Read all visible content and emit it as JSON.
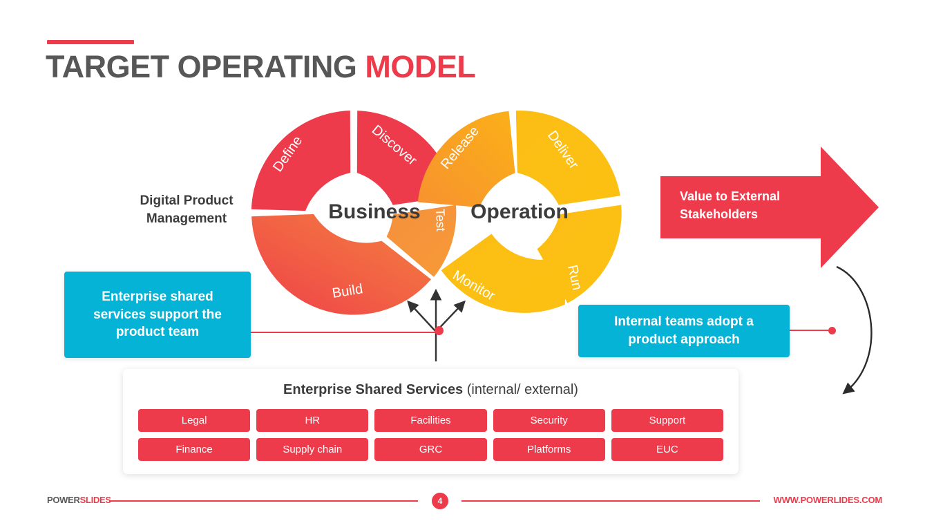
{
  "header": {
    "title_main": "TARGET OPERATING",
    "title_accent": "MODEL"
  },
  "left_label": {
    "line1": "Digital Product",
    "line2": "Management"
  },
  "diagram": {
    "left_ring": {
      "center_label": "Business",
      "segments": [
        "Define",
        "Discover",
        "Test",
        "Build"
      ]
    },
    "right_ring": {
      "center_label": "Operation",
      "segments": [
        "Release",
        "Deliver",
        "Run",
        "Monitor"
      ]
    }
  },
  "value_arrow": {
    "line1": "Value to External",
    "line2": "Stakeholders"
  },
  "callouts": {
    "left": "Enterprise shared services support the product team",
    "right": "Internal teams adopt a product approach"
  },
  "shared_services": {
    "title_bold": "Enterprise Shared Services",
    "title_normal": "(internal/ external)",
    "chips": [
      "Legal",
      "HR",
      "Facilities",
      "Security",
      "Support",
      "Finance",
      "Supply chain",
      "GRC",
      "Platforms",
      "EUC"
    ]
  },
  "footer": {
    "logo_main": "POWER",
    "logo_accent": "SLIDES",
    "page_number": "4",
    "url": "WWW.POWERLIDES.COM"
  },
  "colors": {
    "red": "#ee3b4b",
    "orange": "#f5853f",
    "yellow": "#fcbe14",
    "cyan": "#05b3d6",
    "dark_text": "#3c3c3c",
    "title_gray": "#575757"
  }
}
